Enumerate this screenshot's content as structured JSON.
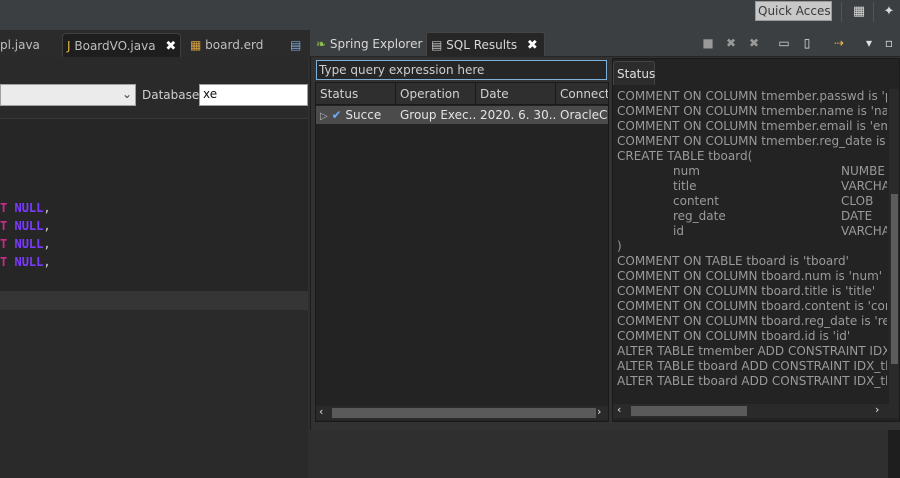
{
  "toolbar": {
    "quick_access": "Quick Access"
  },
  "editor": {
    "tabs": [
      {
        "label": "pl.java"
      },
      {
        "label": "BoardVO.java"
      },
      {
        "label": "board.erd"
      }
    ],
    "database_label": "Database:",
    "database_value": "xe",
    "code_lines": [
      {
        "kw1": "T",
        "kw2": "NULL",
        "comma": ","
      },
      {
        "kw1": "T",
        "kw2": "NULL",
        "comma": ","
      },
      {
        "kw1": "T",
        "kw2": "NULL",
        "comma": ","
      },
      {
        "kw1": "T",
        "kw2": "NULL",
        "comma": ","
      }
    ]
  },
  "panel": {
    "tabs": [
      {
        "label": "Spring Explorer"
      },
      {
        "label": "SQL Results"
      }
    ],
    "query_placeholder": "Type query expression here",
    "results": {
      "columns": [
        "Status",
        "Operation",
        "Date",
        "Connecti"
      ],
      "rows": [
        {
          "status": "Succe",
          "operation": "Group Exec...",
          "date": "2020. 6. 30...",
          "connection": "OracleCo"
        }
      ]
    },
    "status_tab_label": "Status",
    "status_lines": [
      {
        "a": "COMMENT ON COLUMN tmember.passwd is 'pa",
        "b": ""
      },
      {
        "a": "COMMENT ON COLUMN tmember.name is 'nam",
        "b": ""
      },
      {
        "a": "COMMENT ON COLUMN tmember.email is 'emai",
        "b": ""
      },
      {
        "a": "COMMENT ON COLUMN tmember.reg_date is 're",
        "b": ""
      },
      {
        "a": "CREATE TABLE tboard(",
        "b": ""
      },
      {
        "a": "num",
        "b": "NUMBE",
        "indent": true
      },
      {
        "a": "title",
        "b": "VARCHA",
        "indent": true
      },
      {
        "a": "content",
        "b": "CLOB",
        "indent": true
      },
      {
        "a": "reg_date",
        "b": "DATE",
        "indent": true
      },
      {
        "a": "id",
        "b": "VARCHA",
        "indent": true
      },
      {
        "a": ")",
        "b": ""
      },
      {
        "a": "COMMENT ON TABLE tboard is 'tboard'",
        "b": ""
      },
      {
        "a": "COMMENT ON COLUMN tboard.num is 'num'",
        "b": ""
      },
      {
        "a": "COMMENT ON COLUMN tboard.title is 'title'",
        "b": ""
      },
      {
        "a": "COMMENT ON COLUMN tboard.content is 'conte",
        "b": ""
      },
      {
        "a": "COMMENT ON COLUMN tboard.reg_date is 'reg_",
        "b": ""
      },
      {
        "a": "COMMENT ON COLUMN tboard.id is 'id'",
        "b": ""
      },
      {
        "a": "ALTER TABLE tmember ADD CONSTRAINT IDX_tr",
        "b": ""
      },
      {
        "a": "ALTER TABLE tboard ADD CONSTRAINT IDX_tboa",
        "b": ""
      },
      {
        "a": "ALTER TABLE tboard ADD CONSTRAINT IDX_tboa",
        "b": ""
      }
    ]
  },
  "colors": {
    "keyword_t": "#cc2a8a",
    "keyword_null": "#7b3bff",
    "focus_border": "#7fb0d8"
  }
}
